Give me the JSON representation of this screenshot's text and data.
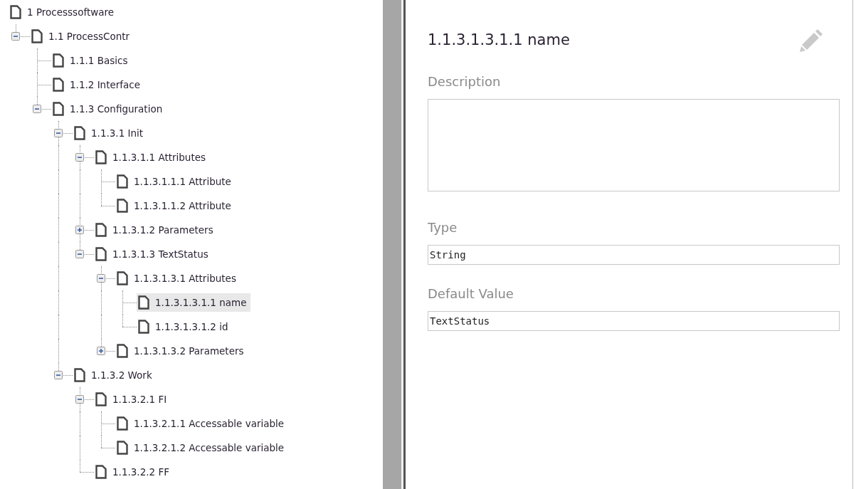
{
  "tree": [
    {
      "label": "1 Processsoftware",
      "selected": false,
      "children": [
        {
          "label": "1.1 ProcessContr",
          "selected": false,
          "expanded": true,
          "children": [
            {
              "label": "1.1.1 Basics",
              "selected": false
            },
            {
              "label": "1.1.2 Interface",
              "selected": false
            },
            {
              "label": "1.1.3 Configuration",
              "selected": false,
              "expanded": true,
              "children": [
                {
                  "label": "1.1.3.1 Init",
                  "selected": false,
                  "expanded": true,
                  "children": [
                    {
                      "label": "1.1.3.1.1 Attributes",
                      "selected": false,
                      "expanded": true,
                      "children": [
                        {
                          "label": "1.1.3.1.1.1 Attribute",
                          "selected": false
                        },
                        {
                          "label": "1.1.3.1.1.2 Attribute",
                          "selected": false
                        }
                      ]
                    },
                    {
                      "label": "1.1.3.1.2 Parameters",
                      "selected": false,
                      "expanded": false
                    },
                    {
                      "label": "1.1.3.1.3 TextStatus",
                      "selected": false,
                      "expanded": true,
                      "children": [
                        {
                          "label": "1.1.3.1.3.1 Attributes",
                          "selected": false,
                          "expanded": true,
                          "children": [
                            {
                              "label": "1.1.3.1.3.1.1 name",
                              "selected": true
                            },
                            {
                              "label": "1.1.3.1.3.1.2 id",
                              "selected": false
                            }
                          ]
                        },
                        {
                          "label": "1.1.3.1.3.2 Parameters",
                          "selected": false,
                          "expanded": false
                        }
                      ]
                    }
                  ]
                },
                {
                  "label": "1.1.3.2 Work",
                  "selected": false,
                  "expanded": true,
                  "children": [
                    {
                      "label": "1.1.3.2.1 FI",
                      "selected": false,
                      "expanded": true,
                      "children": [
                        {
                          "label": "1.1.3.2.1.1 Accessable variable",
                          "selected": false
                        },
                        {
                          "label": "1.1.3.2.1.2 Accessable variable",
                          "selected": false
                        }
                      ]
                    },
                    {
                      "label": "1.1.3.2.2 FF",
                      "selected": false
                    }
                  ]
                }
              ]
            }
          ]
        }
      ]
    }
  ],
  "detail": {
    "title": "1.1.3.1.3.1.1 name",
    "fields": [
      {
        "kind": "textarea",
        "label": "Description"
      },
      {
        "kind": "text",
        "label": "Type",
        "value": "String"
      },
      {
        "kind": "text",
        "label": "Default Value",
        "value": "TextStatus"
      }
    ]
  }
}
